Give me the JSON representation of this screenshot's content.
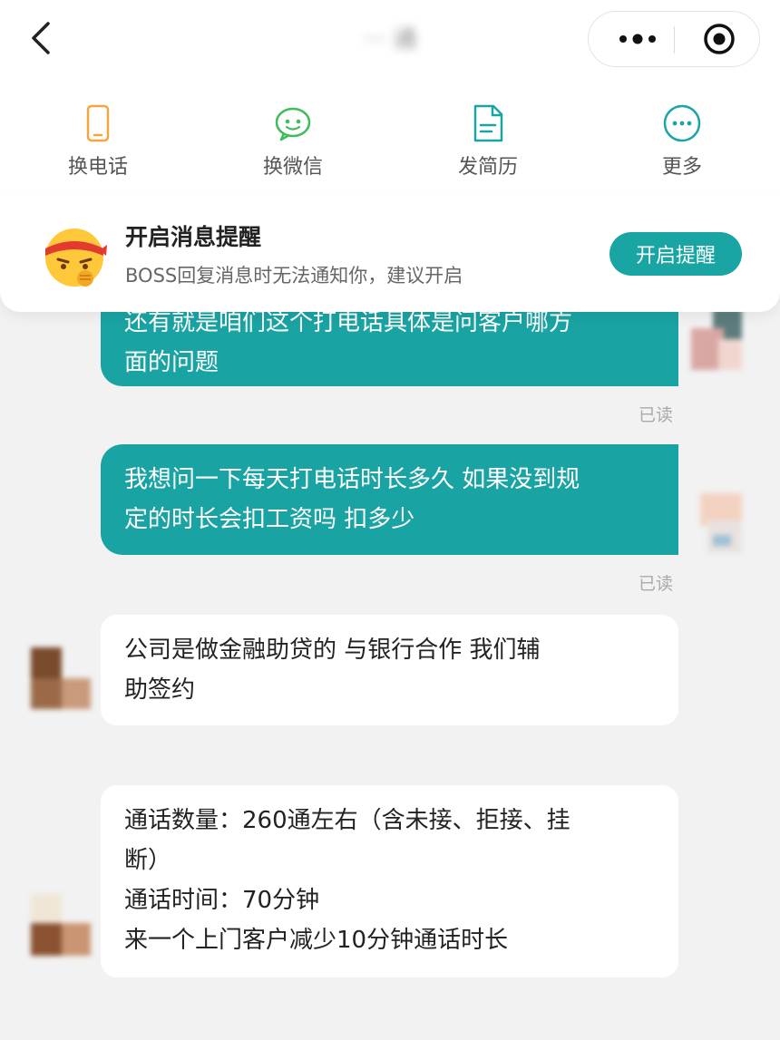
{
  "header": {
    "title": "··· 通"
  },
  "actions": [
    {
      "label": "换电话",
      "icon": "phone-icon",
      "color": "#f3a53f"
    },
    {
      "label": "换微信",
      "icon": "wechat-icon",
      "color": "#3ebd5b"
    },
    {
      "label": "发简历",
      "icon": "resume-icon",
      "color": "#1aa5a5"
    },
    {
      "label": "更多",
      "icon": "more-icon",
      "color": "#1aa5a5"
    }
  ],
  "notice": {
    "title": "开启消息提醒",
    "desc": "BOSS回复消息时无法通知你，建议开启",
    "button": "开启提醒"
  },
  "messages": {
    "m1_line1": "还有就是咱们这个打电话具体是问客户哪方",
    "m1_line2": "面的问题",
    "m1_status": "已读",
    "m2_line1": "我想问一下每天打电话时长多久 如果没到规",
    "m2_line2": "定的时长会扣工资吗 扣多少",
    "m2_status": "已读",
    "m3_line1": "公司是做金融助贷的   与银行合作  我们辅",
    "m3_line2": "助签约",
    "m4_line1": "通话数量：260通左右（含未接、拒接、挂",
    "m4_line2": "断）",
    "m4_line3": "通话时间：70分钟",
    "m4_line4": "来一个上门客户减少10分钟通话时长"
  },
  "colors": {
    "accent": "#1aa5a5",
    "outgoing_bubble": "#1aa3a3"
  }
}
